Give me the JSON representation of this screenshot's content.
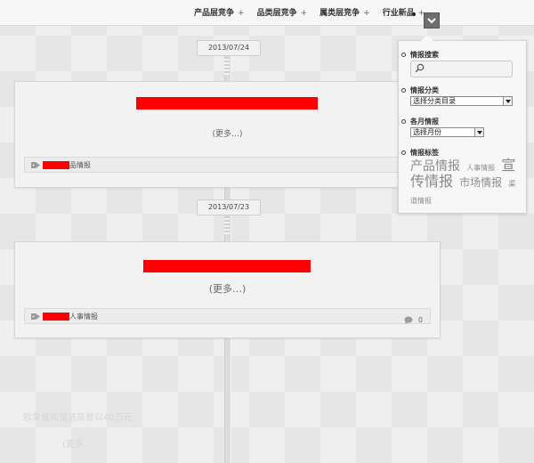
{
  "nav": {
    "items": [
      {
        "label": "产品层竞争",
        "suffix": "+"
      },
      {
        "label": "品类层竞争",
        "suffix": "+"
      },
      {
        "label": "属类层竞争",
        "suffix": "+"
      },
      {
        "label": "行业新品",
        "suffix": "+"
      }
    ]
  },
  "timeline": {
    "entries": [
      {
        "date": "2013/07/24",
        "more": "(更多…)",
        "tag_suffix": "品情报"
      },
      {
        "date": "2013/07/23",
        "more": "(更多…)",
        "tag_suffix": "人事情报",
        "comment_count": "0"
      }
    ]
  },
  "ghost": {
    "line1": "欧莱雅和宝洁高管以40万元",
    "line2": "(更多"
  },
  "panel": {
    "search": {
      "title": "情报搜索",
      "value": ""
    },
    "category": {
      "title": "情报分类",
      "selected": "选择分类目录"
    },
    "monthly": {
      "title": "各月情报",
      "selected": "选择月份"
    },
    "tags": {
      "title": "情报标签",
      "cloud": [
        {
          "text": "产品情报"
        },
        {
          "text": "人事情报"
        },
        {
          "text": "宣传情报"
        },
        {
          "text": "市场情报"
        },
        {
          "text": "渠道情报"
        }
      ]
    }
  },
  "colors": {
    "redaction": "#ff0000",
    "toggle": "#6f6f6f"
  }
}
